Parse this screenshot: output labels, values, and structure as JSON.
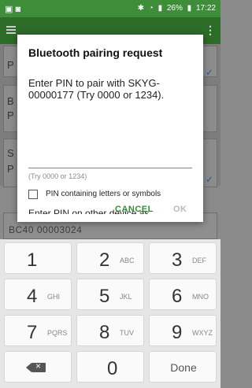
{
  "status_bar": {
    "battery": "26%",
    "time": "17:22"
  },
  "background": {
    "card_letters": [
      "P",
      "B",
      "P",
      "S",
      "P"
    ],
    "visible_device": "BC40 00003024"
  },
  "dialog": {
    "title": "Bluetooth pairing request",
    "message": "Enter PIN to pair with SKYG-00000177 (Try 0000 or 1234).",
    "pin_value": "",
    "hint": "(Try 0000 or 1234)",
    "checkbox_label": "PIN containing letters or symbols",
    "truncated_text": "Enter PIN on other device as",
    "cancel_label": "CANCEL",
    "ok_label": "OK",
    "accent_color": "#3a8a3a"
  },
  "keypad": {
    "keys": [
      {
        "digit": "1",
        "letters": ""
      },
      {
        "digit": "2",
        "letters": "ABC"
      },
      {
        "digit": "3",
        "letters": "DEF"
      },
      {
        "digit": "4",
        "letters": "GHI"
      },
      {
        "digit": "5",
        "letters": "JKL"
      },
      {
        "digit": "6",
        "letters": "MNO"
      },
      {
        "digit": "7",
        "letters": "PQRS"
      },
      {
        "digit": "8",
        "letters": "TUV"
      },
      {
        "digit": "9",
        "letters": "WXYZ"
      }
    ],
    "zero": "0",
    "done_label": "Done",
    "backspace_icon": "backspace-icon"
  }
}
